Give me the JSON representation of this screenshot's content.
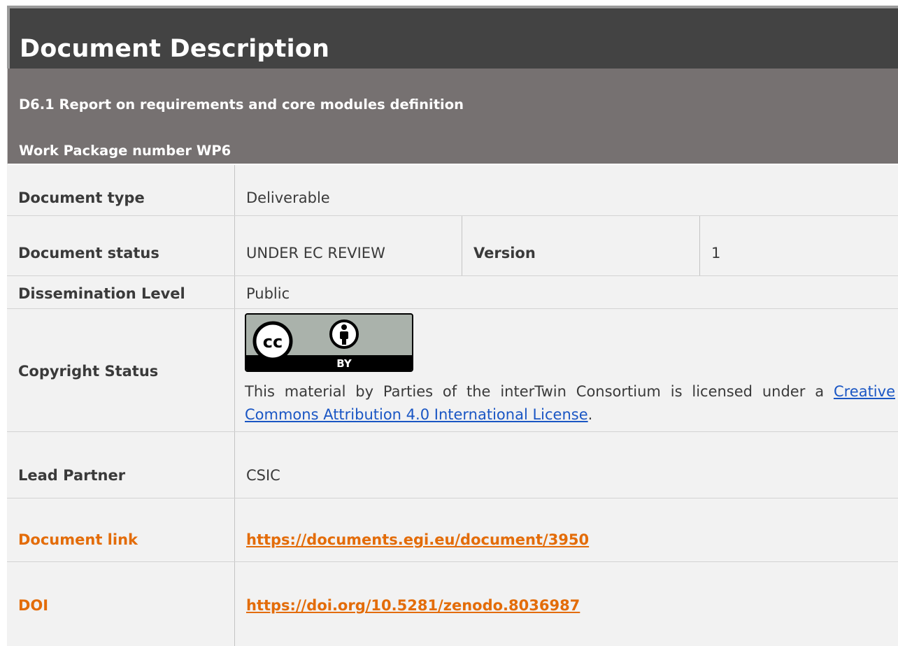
{
  "title": "Document Description",
  "deliverable": "D6.1 Report on requirements and core modules definition",
  "work_package": "Work Package number WP6",
  "rows": {
    "doc_type": {
      "label": "Document type",
      "value": "Deliverable"
    },
    "doc_status": {
      "label": "Document status",
      "value": "UNDER EC REVIEW",
      "version_label": "Version",
      "version_value": "1"
    },
    "dissemination": {
      "label": "Dissemination Level",
      "value": "Public"
    },
    "copyright": {
      "label": "Copyright Status",
      "badge_cc": "cc",
      "badge_by": "BY",
      "text_before": "This material by Parties of the interTwin Consortium is licensed under a ",
      "link_text": "Creative Commons Attribution 4.0 International License",
      "text_after": "."
    },
    "lead_partner": {
      "label": "Lead Partner",
      "value": "CSIC"
    },
    "doc_link": {
      "label": "Document link",
      "value": "https://documents.egi.eu/document/3950"
    },
    "doi": {
      "label": "DOI",
      "value": "https://doi.org/10.5281/zenodo.8036987"
    }
  },
  "colors": {
    "title_bg": "#434343",
    "grey_row": "#767171",
    "accent_orange": "#e36c09",
    "link_blue": "#1a56c4",
    "cell_bg": "#f2f2f2"
  }
}
